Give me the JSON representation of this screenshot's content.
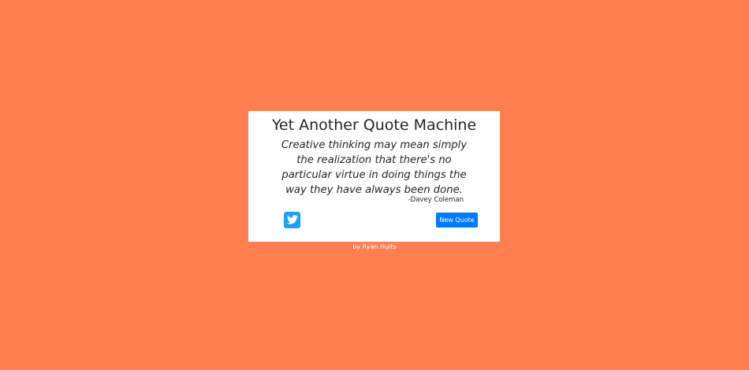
{
  "app": {
    "title": "Yet Another Quote Machine",
    "background_color": "#ff7f50",
    "accent_color": "#007bff",
    "twitter_color": "#1da1f2"
  },
  "quote": {
    "text": "Creative thinking may mean simply the realization that there's no particular virtue in doing things the way they have always been done.",
    "author": "-Davey Coleman"
  },
  "actions": {
    "tweet_icon": "twitter-icon",
    "new_quote_label": "New Quote"
  },
  "footer": {
    "credit": "by Ryan Hults"
  }
}
